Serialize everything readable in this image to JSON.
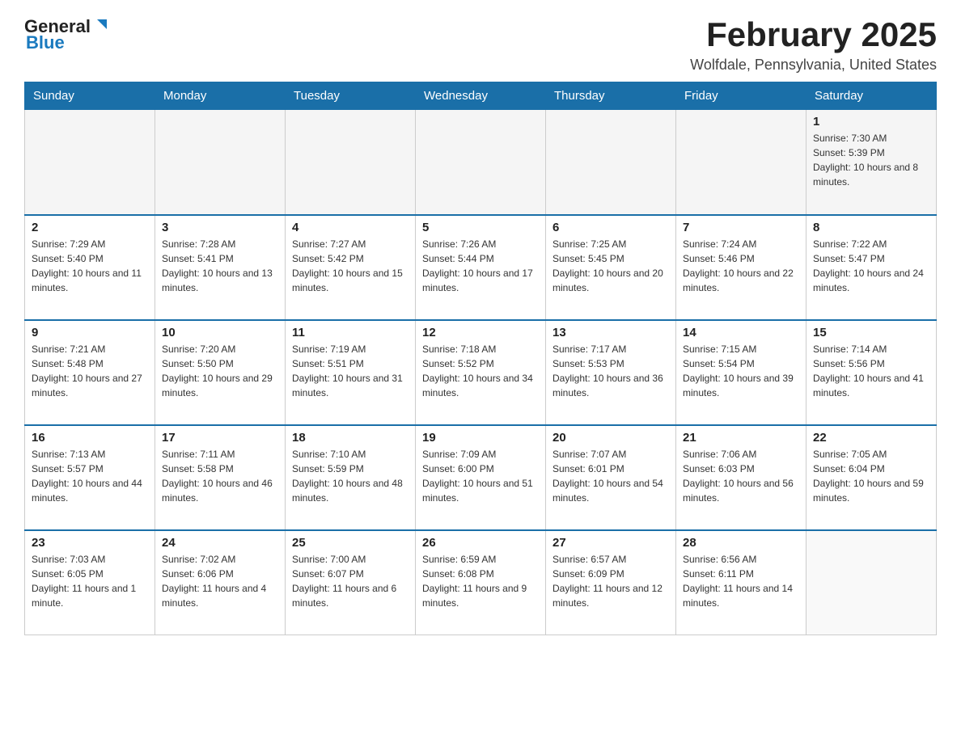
{
  "header": {
    "logo_general": "General",
    "logo_blue": "Blue",
    "month_title": "February 2025",
    "location": "Wolfdale, Pennsylvania, United States"
  },
  "days_of_week": [
    "Sunday",
    "Monday",
    "Tuesday",
    "Wednesday",
    "Thursday",
    "Friday",
    "Saturday"
  ],
  "weeks": [
    [
      {
        "day": "",
        "sunrise": "",
        "sunset": "",
        "daylight": ""
      },
      {
        "day": "",
        "sunrise": "",
        "sunset": "",
        "daylight": ""
      },
      {
        "day": "",
        "sunrise": "",
        "sunset": "",
        "daylight": ""
      },
      {
        "day": "",
        "sunrise": "",
        "sunset": "",
        "daylight": ""
      },
      {
        "day": "",
        "sunrise": "",
        "sunset": "",
        "daylight": ""
      },
      {
        "day": "",
        "sunrise": "",
        "sunset": "",
        "daylight": ""
      },
      {
        "day": "1",
        "sunrise": "Sunrise: 7:30 AM",
        "sunset": "Sunset: 5:39 PM",
        "daylight": "Daylight: 10 hours and 8 minutes."
      }
    ],
    [
      {
        "day": "2",
        "sunrise": "Sunrise: 7:29 AM",
        "sunset": "Sunset: 5:40 PM",
        "daylight": "Daylight: 10 hours and 11 minutes."
      },
      {
        "day": "3",
        "sunrise": "Sunrise: 7:28 AM",
        "sunset": "Sunset: 5:41 PM",
        "daylight": "Daylight: 10 hours and 13 minutes."
      },
      {
        "day": "4",
        "sunrise": "Sunrise: 7:27 AM",
        "sunset": "Sunset: 5:42 PM",
        "daylight": "Daylight: 10 hours and 15 minutes."
      },
      {
        "day": "5",
        "sunrise": "Sunrise: 7:26 AM",
        "sunset": "Sunset: 5:44 PM",
        "daylight": "Daylight: 10 hours and 17 minutes."
      },
      {
        "day": "6",
        "sunrise": "Sunrise: 7:25 AM",
        "sunset": "Sunset: 5:45 PM",
        "daylight": "Daylight: 10 hours and 20 minutes."
      },
      {
        "day": "7",
        "sunrise": "Sunrise: 7:24 AM",
        "sunset": "Sunset: 5:46 PM",
        "daylight": "Daylight: 10 hours and 22 minutes."
      },
      {
        "day": "8",
        "sunrise": "Sunrise: 7:22 AM",
        "sunset": "Sunset: 5:47 PM",
        "daylight": "Daylight: 10 hours and 24 minutes."
      }
    ],
    [
      {
        "day": "9",
        "sunrise": "Sunrise: 7:21 AM",
        "sunset": "Sunset: 5:48 PM",
        "daylight": "Daylight: 10 hours and 27 minutes."
      },
      {
        "day": "10",
        "sunrise": "Sunrise: 7:20 AM",
        "sunset": "Sunset: 5:50 PM",
        "daylight": "Daylight: 10 hours and 29 minutes."
      },
      {
        "day": "11",
        "sunrise": "Sunrise: 7:19 AM",
        "sunset": "Sunset: 5:51 PM",
        "daylight": "Daylight: 10 hours and 31 minutes."
      },
      {
        "day": "12",
        "sunrise": "Sunrise: 7:18 AM",
        "sunset": "Sunset: 5:52 PM",
        "daylight": "Daylight: 10 hours and 34 minutes."
      },
      {
        "day": "13",
        "sunrise": "Sunrise: 7:17 AM",
        "sunset": "Sunset: 5:53 PM",
        "daylight": "Daylight: 10 hours and 36 minutes."
      },
      {
        "day": "14",
        "sunrise": "Sunrise: 7:15 AM",
        "sunset": "Sunset: 5:54 PM",
        "daylight": "Daylight: 10 hours and 39 minutes."
      },
      {
        "day": "15",
        "sunrise": "Sunrise: 7:14 AM",
        "sunset": "Sunset: 5:56 PM",
        "daylight": "Daylight: 10 hours and 41 minutes."
      }
    ],
    [
      {
        "day": "16",
        "sunrise": "Sunrise: 7:13 AM",
        "sunset": "Sunset: 5:57 PM",
        "daylight": "Daylight: 10 hours and 44 minutes."
      },
      {
        "day": "17",
        "sunrise": "Sunrise: 7:11 AM",
        "sunset": "Sunset: 5:58 PM",
        "daylight": "Daylight: 10 hours and 46 minutes."
      },
      {
        "day": "18",
        "sunrise": "Sunrise: 7:10 AM",
        "sunset": "Sunset: 5:59 PM",
        "daylight": "Daylight: 10 hours and 48 minutes."
      },
      {
        "day": "19",
        "sunrise": "Sunrise: 7:09 AM",
        "sunset": "Sunset: 6:00 PM",
        "daylight": "Daylight: 10 hours and 51 minutes."
      },
      {
        "day": "20",
        "sunrise": "Sunrise: 7:07 AM",
        "sunset": "Sunset: 6:01 PM",
        "daylight": "Daylight: 10 hours and 54 minutes."
      },
      {
        "day": "21",
        "sunrise": "Sunrise: 7:06 AM",
        "sunset": "Sunset: 6:03 PM",
        "daylight": "Daylight: 10 hours and 56 minutes."
      },
      {
        "day": "22",
        "sunrise": "Sunrise: 7:05 AM",
        "sunset": "Sunset: 6:04 PM",
        "daylight": "Daylight: 10 hours and 59 minutes."
      }
    ],
    [
      {
        "day": "23",
        "sunrise": "Sunrise: 7:03 AM",
        "sunset": "Sunset: 6:05 PM",
        "daylight": "Daylight: 11 hours and 1 minute."
      },
      {
        "day": "24",
        "sunrise": "Sunrise: 7:02 AM",
        "sunset": "Sunset: 6:06 PM",
        "daylight": "Daylight: 11 hours and 4 minutes."
      },
      {
        "day": "25",
        "sunrise": "Sunrise: 7:00 AM",
        "sunset": "Sunset: 6:07 PM",
        "daylight": "Daylight: 11 hours and 6 minutes."
      },
      {
        "day": "26",
        "sunrise": "Sunrise: 6:59 AM",
        "sunset": "Sunset: 6:08 PM",
        "daylight": "Daylight: 11 hours and 9 minutes."
      },
      {
        "day": "27",
        "sunrise": "Sunrise: 6:57 AM",
        "sunset": "Sunset: 6:09 PM",
        "daylight": "Daylight: 11 hours and 12 minutes."
      },
      {
        "day": "28",
        "sunrise": "Sunrise: 6:56 AM",
        "sunset": "Sunset: 6:11 PM",
        "daylight": "Daylight: 11 hours and 14 minutes."
      },
      {
        "day": "",
        "sunrise": "",
        "sunset": "",
        "daylight": ""
      }
    ]
  ]
}
